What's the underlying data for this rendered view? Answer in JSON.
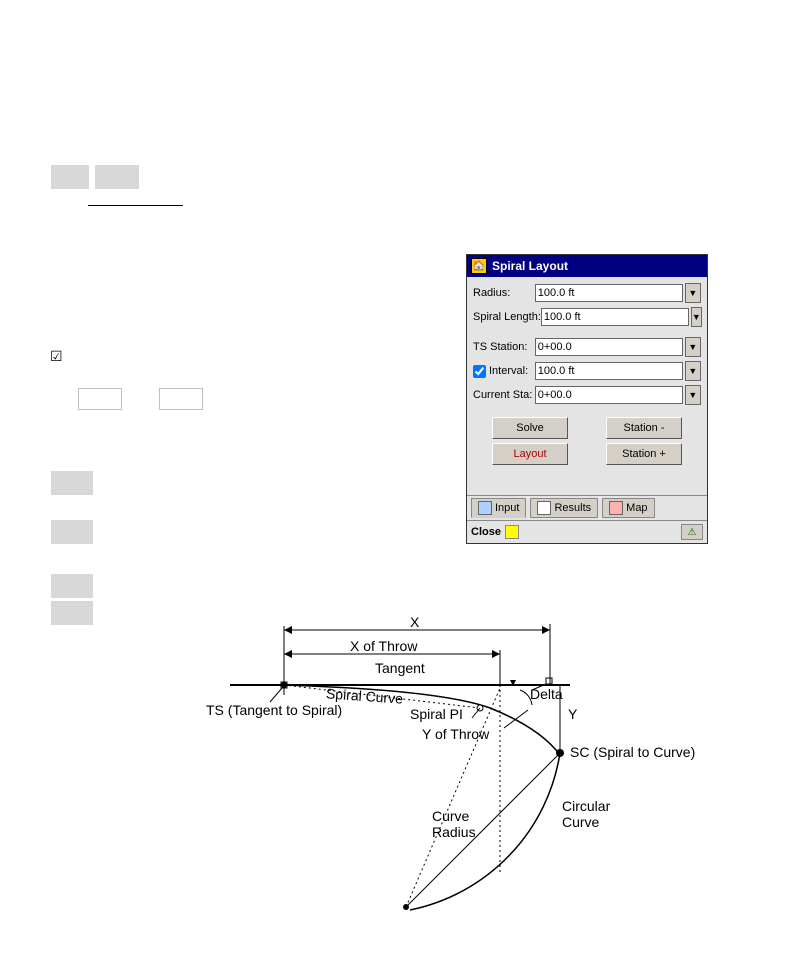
{
  "dialog": {
    "title": "Spiral Layout",
    "fields": {
      "radius_label": "Radius:",
      "radius_value": "100.0 ft",
      "spiral_length_label": "Spiral Length:",
      "spiral_length_value": "100.0 ft",
      "ts_station_label": "TS Station:",
      "ts_station_value": "0+00.0",
      "interval_label": "Interval:",
      "interval_value": "100.0 ft",
      "current_sta_label": "Current Sta:",
      "current_sta_value": "0+00.0"
    },
    "buttons": {
      "solve": "Solve",
      "station_minus": "Station -",
      "layout": "Layout",
      "station_plus": "Station +"
    },
    "tabs": {
      "input": "Input",
      "results": "Results",
      "map": "Map"
    },
    "status": {
      "close": "Close"
    }
  },
  "diagram": {
    "x": "X",
    "x_of_throw": "X of Throw",
    "tangent": "Tangent",
    "spiral_curve": "Spiral Curve",
    "ts": "TS (Tangent to Spiral)",
    "spiral_pi": "Spiral PI",
    "y_of_throw": "Y of Throw",
    "delta": "Delta",
    "y": "Y",
    "sc": "SC (Spiral to Curve)",
    "curve_radius": "Curve\nRadius",
    "circular_curve": "Circular\nCurve"
  }
}
